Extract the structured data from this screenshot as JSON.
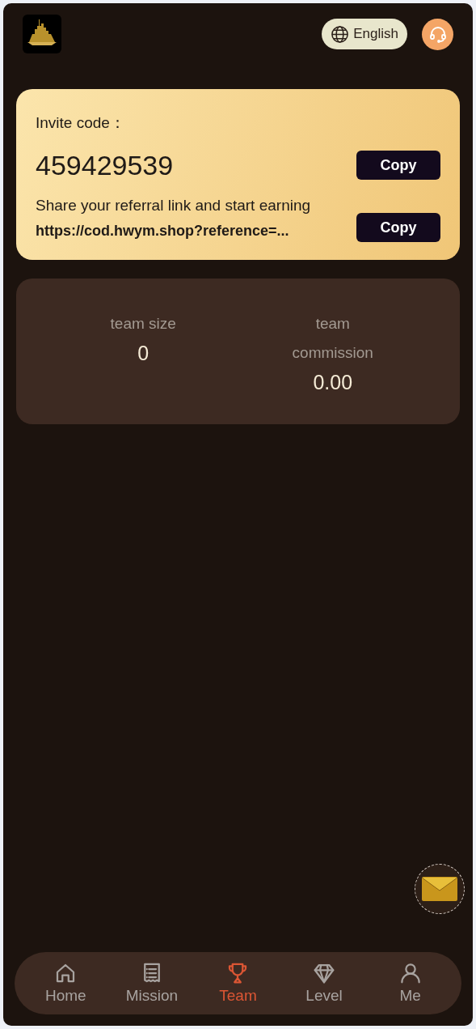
{
  "header": {
    "language": "English"
  },
  "invite": {
    "label": "Invite code：",
    "code": "459429539",
    "copy_code": "Copy",
    "share_text": "Share your referral link and start earning",
    "link": "https://cod.hwym.shop?reference=...",
    "copy_link": "Copy"
  },
  "stats": [
    {
      "label": "team size",
      "value": "0"
    },
    {
      "label": "team commission",
      "value": "0.00"
    }
  ],
  "nav": [
    {
      "kind": "home",
      "label": "Home",
      "selected": false
    },
    {
      "kind": "mission",
      "label": "Mission",
      "selected": false
    },
    {
      "kind": "team",
      "label": "Team",
      "selected": true
    },
    {
      "kind": "level",
      "label": "Level",
      "selected": false
    },
    {
      "kind": "me",
      "label": "Me",
      "selected": false
    }
  ]
}
